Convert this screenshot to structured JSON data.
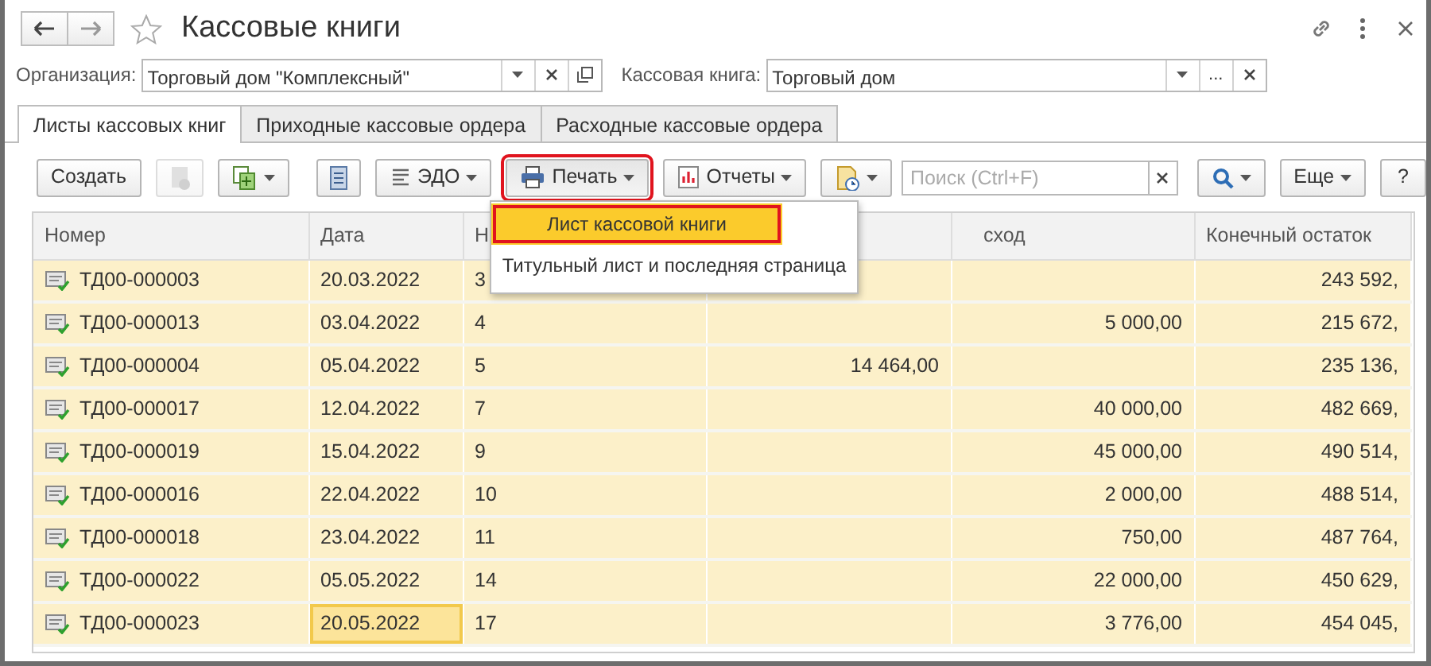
{
  "window": {
    "title": "Кассовые книги",
    "favorite": false
  },
  "filters": [
    {
      "label": "Организация:",
      "value": "Торговый дом \"Комплексный\"",
      "kind": "open"
    },
    {
      "label": "Кассовая книга:",
      "value": "Торговый дом",
      "kind": "choose",
      "choose_text": "..."
    }
  ],
  "tabs": [
    {
      "label": "Листы кассовых книг",
      "selected": true
    },
    {
      "label": "Приходные кассовые ордера",
      "selected": false
    },
    {
      "label": "Расходные кассовые ордера",
      "selected": false
    }
  ],
  "toolbar": [
    {
      "kind": "button",
      "text": "Создать"
    },
    {
      "kind": "icon",
      "disabled": true,
      "dropdown": false
    },
    {
      "kind": "icon",
      "disabled": false,
      "dropdown": true
    },
    {
      "kind": "icon",
      "disabled": false,
      "dropdown": false
    },
    {
      "kind": "button",
      "text": "ЭДО",
      "dropdown": true
    },
    {
      "kind": "button",
      "text": "Печать",
      "dropdown": true,
      "highlighted": true,
      "expanded": true
    },
    {
      "kind": "button",
      "text": "Отчеты",
      "dropdown": true
    },
    {
      "kind": "icon",
      "disabled": false,
      "dropdown": true
    },
    {
      "kind": "search",
      "placeholder": "Поиск (Ctrl+F)"
    },
    {
      "kind": "icon",
      "disabled": false,
      "dropdown": true
    },
    {
      "kind": "button",
      "text": "Еще",
      "dropdown": true
    },
    {
      "kind": "button",
      "text": "?"
    }
  ],
  "print_menu": [
    {
      "label": "Лист кассовой книги",
      "selected": true,
      "highlighted": true
    },
    {
      "label": "Титульный лист и последняя страница",
      "selected": false,
      "highlighted": false
    }
  ],
  "table": {
    "columns": [
      "Номер",
      "Дата",
      "Н",
      "",
      "сход",
      "Конечный остаток"
    ],
    "rows": [
      {
        "cells": [
          "ТД00-000003",
          "20.03.2022",
          "3",
          "",
          "",
          "243 592,"
        ],
        "current": false
      },
      {
        "cells": [
          "ТД00-000013",
          "03.04.2022",
          "4",
          "",
          "5 000,00",
          "215 672,"
        ],
        "current": false
      },
      {
        "cells": [
          "ТД00-000004",
          "05.04.2022",
          "5",
          "14 464,00",
          "",
          "235 136,"
        ],
        "current": false
      },
      {
        "cells": [
          "ТД00-000017",
          "12.04.2022",
          "7",
          "",
          "40 000,00",
          "482 669,"
        ],
        "current": false
      },
      {
        "cells": [
          "ТД00-000019",
          "15.04.2022",
          "9",
          "",
          "45 000,00",
          "490 514,"
        ],
        "current": false
      },
      {
        "cells": [
          "ТД00-000016",
          "22.04.2022",
          "10",
          "",
          "2 000,00",
          "488 514,"
        ],
        "current": false
      },
      {
        "cells": [
          "ТД00-000018",
          "23.04.2022",
          "11",
          "",
          "750,00",
          "487 764,"
        ],
        "current": false
      },
      {
        "cells": [
          "ТД00-000022",
          "05.05.2022",
          "14",
          "",
          "22 000,00",
          "450 629,"
        ],
        "current": false
      },
      {
        "cells": [
          "ТД00-000023",
          "20.05.2022",
          "17",
          "",
          "3 776,00",
          "454 045,"
        ],
        "current": true
      }
    ]
  }
}
